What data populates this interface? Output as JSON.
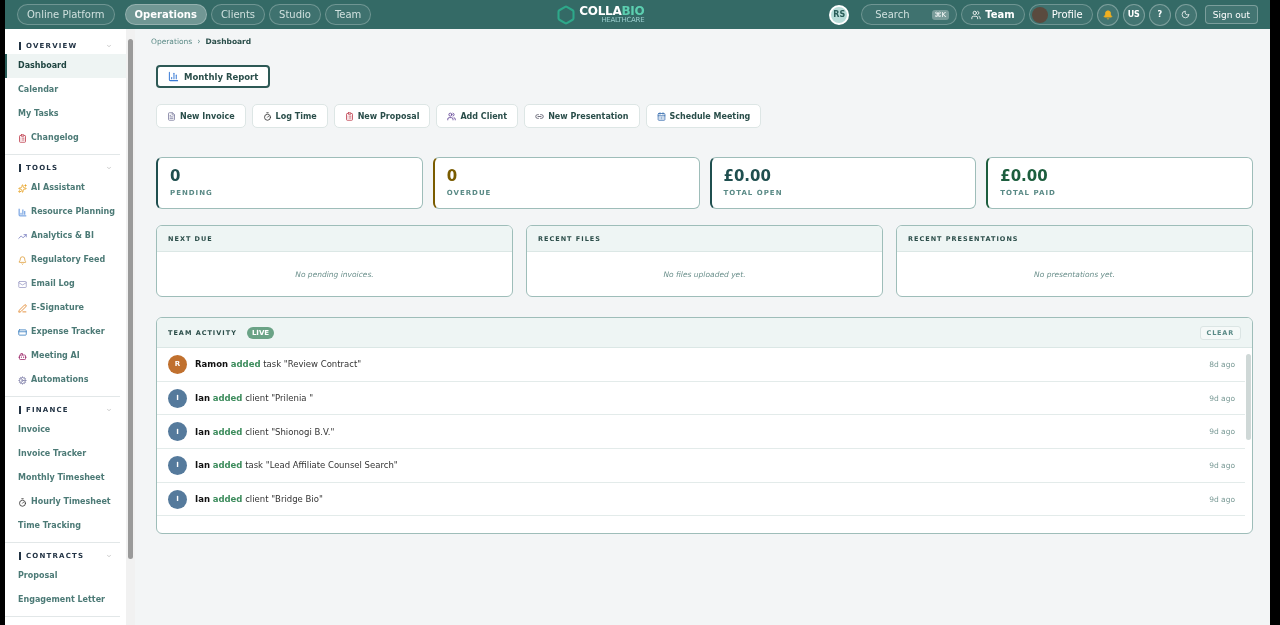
{
  "topnav": {
    "platform": "Online Platform",
    "tabs": [
      {
        "label": "Operations",
        "selected": true
      },
      {
        "label": "Clients",
        "selected": false
      },
      {
        "label": "Studio",
        "selected": false
      },
      {
        "label": "Team",
        "selected": false
      }
    ]
  },
  "logo": {
    "part1": "COLLA",
    "part2": "BIO",
    "tagline": "HEALTHCARE"
  },
  "userbar": {
    "initials": "RS",
    "search": "Search",
    "shortcut": "⌘K",
    "team": "Team",
    "profile": "Profile",
    "locale": "US",
    "help": "?",
    "signout": "Sign out"
  },
  "sidebar": [
    {
      "title": "OVERVIEW",
      "expanded": true,
      "items": [
        {
          "label": "Dashboard",
          "selected": true
        },
        {
          "label": "Calendar",
          "selected": false
        },
        {
          "label": "My Tasks",
          "selected": false
        },
        {
          "label": "Changelog",
          "selected": false,
          "kind": "clipboard"
        }
      ]
    },
    {
      "title": "TOOLS",
      "expanded": true,
      "items": [
        {
          "label": "AI Assistant",
          "selected": false,
          "kind": "sparkles"
        },
        {
          "label": "Resource Planning",
          "selected": false,
          "kind": "chart"
        },
        {
          "label": "Analytics & BI",
          "selected": false,
          "kind": "trend"
        },
        {
          "label": "Regulatory Feed",
          "selected": false,
          "kind": "bell"
        },
        {
          "label": "Email Log",
          "selected": false,
          "kind": "mail"
        },
        {
          "label": "E-Signature",
          "selected": false,
          "kind": "pen"
        },
        {
          "label": "Expense Tracker",
          "selected": false,
          "kind": "card"
        },
        {
          "label": "Meeting AI",
          "selected": false,
          "kind": "bot"
        },
        {
          "label": "Automations",
          "selected": false,
          "kind": "cog"
        }
      ]
    },
    {
      "title": "FINANCE",
      "expanded": true,
      "items": [
        {
          "label": "Invoice",
          "selected": false
        },
        {
          "label": "Invoice Tracker",
          "selected": false
        },
        {
          "label": "Monthly Timesheet",
          "selected": false
        },
        {
          "label": "Hourly Timesheet",
          "selected": false,
          "kind": "timer"
        },
        {
          "label": "Time Tracking",
          "selected": false
        }
      ]
    },
    {
      "title": "CONTRACTS",
      "expanded": true,
      "items": [
        {
          "label": "Proposal",
          "selected": false
        },
        {
          "label": "Engagement Letter",
          "selected": false
        }
      ]
    }
  ],
  "breadcrumb": {
    "items": [
      "Operations",
      "Dashboard"
    ],
    "separator": "›"
  },
  "report_button": {
    "label": "Monthly Report",
    "kind": "chart"
  },
  "quick_actions": [
    {
      "label": "New Invoice",
      "kind": "file"
    },
    {
      "label": "Log Time",
      "kind": "timer"
    },
    {
      "label": "New Proposal",
      "kind": "clipboard"
    },
    {
      "label": "Add Client",
      "kind": "users"
    },
    {
      "label": "New Presentation",
      "kind": "link"
    },
    {
      "label": "Schedule Meeting",
      "kind": "calendar"
    }
  ],
  "stats": [
    {
      "value": "0",
      "label": "PENDING",
      "color": "#1f4f4f"
    },
    {
      "value": "0",
      "label": "OVERDUE",
      "color": "#7a5c00"
    },
    {
      "value": "£0.00",
      "label": "TOTAL OPEN",
      "color": "#1f4f4f"
    },
    {
      "value": "£0.00",
      "label": "TOTAL PAID",
      "color": "#1d5e3e"
    }
  ],
  "panels": [
    {
      "title": "NEXT DUE",
      "empty": "No pending invoices."
    },
    {
      "title": "RECENT FILES",
      "empty": "No files uploaded yet."
    },
    {
      "title": "RECENT PRESENTATIONS",
      "empty": "No presentations yet."
    }
  ],
  "activity": {
    "title": "TEAM ACTIVITY",
    "badge": "LIVE",
    "clear": "CLEAR",
    "rows": [
      {
        "initial": "R",
        "color": "#c0702e",
        "actor": "Ramon",
        "verb": "added",
        "object": "task \"Review Contract\"",
        "time": "8d ago"
      },
      {
        "initial": "I",
        "color": "#557a9c",
        "actor": "Ian",
        "verb": "added",
        "object": "client \"Prilenia \"",
        "time": "9d ago"
      },
      {
        "initial": "I",
        "color": "#557a9c",
        "actor": "Ian",
        "verb": "added",
        "object": "client \"Shionogi B.V.\"",
        "time": "9d ago"
      },
      {
        "initial": "I",
        "color": "#557a9c",
        "actor": "Ian",
        "verb": "added",
        "object": "task \"Lead Affiliate Counsel Search\"",
        "time": "9d ago"
      },
      {
        "initial": "I",
        "color": "#557a9c",
        "actor": "Ian",
        "verb": "added",
        "object": "client \"Bridge Bio\"",
        "time": "9d ago"
      }
    ]
  }
}
